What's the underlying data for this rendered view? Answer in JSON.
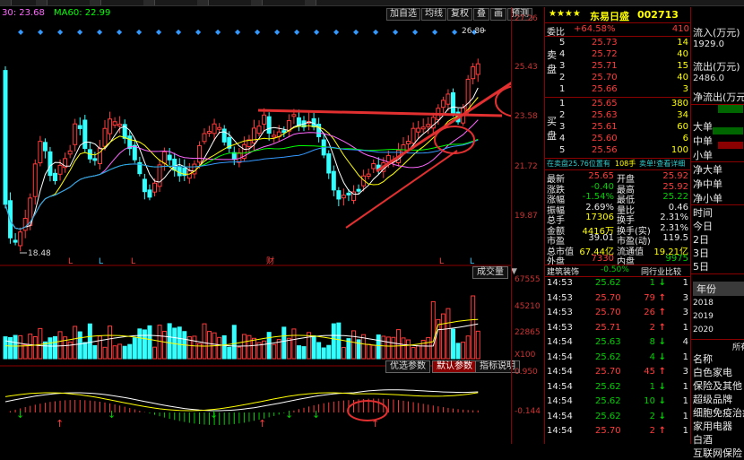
{
  "ma_labels": {
    "ma30": "30: 23.68",
    "ma60": "MA60: 22.99"
  },
  "toolbar": [
    "加自选",
    "均线",
    "复权",
    "叠",
    "画",
    "预测"
  ],
  "price_axis": [
    "27.26",
    "25.43",
    "23.58",
    "21.72",
    "19.87"
  ],
  "volume_axis": [
    "67555",
    "45210",
    "22865",
    "X100"
  ],
  "macd_axis": [
    "0.950",
    "-0.144"
  ],
  "price_annotations": {
    "high": "26.80",
    "low": "18.48"
  },
  "volume_button": "成交量",
  "bottom_buttons": [
    "优选参数",
    "默认参数",
    "指标说明"
  ],
  "marker_labels": [
    "L",
    "L",
    "L",
    "财",
    "L",
    "L"
  ],
  "stock": {
    "stars": "★★★★",
    "name": "东易日盛",
    "code": "002713"
  },
  "weibi": {
    "label": "委比",
    "value": "+64.58%",
    "count": "410"
  },
  "sell_label": "卖盘",
  "buy_label": "买盘",
  "sell": [
    {
      "lvl": "5",
      "price": "25.73",
      "vol": "14"
    },
    {
      "lvl": "4",
      "price": "25.72",
      "vol": "40"
    },
    {
      "lvl": "3",
      "price": "25.71",
      "vol": "15"
    },
    {
      "lvl": "2",
      "price": "25.70",
      "vol": "40"
    },
    {
      "lvl": "1",
      "price": "25.66",
      "vol": "3"
    }
  ],
  "buy": [
    {
      "lvl": "1",
      "price": "25.65",
      "vol": "380"
    },
    {
      "lvl": "2",
      "price": "25.63",
      "vol": "34"
    },
    {
      "lvl": "3",
      "price": "25.61",
      "vol": "60"
    },
    {
      "lvl": "4",
      "price": "25.60",
      "vol": "6"
    },
    {
      "lvl": "5",
      "price": "25.56",
      "vol": "100"
    }
  ],
  "buy_sell_info": {
    "left": "在卖盘25.76位置有",
    "mid": "108手",
    "right": "卖单!查看详细"
  },
  "stats": [
    {
      "k1": "最新",
      "v1": "25.65",
      "k2": "开盘",
      "v2": "25.92",
      "c1": "red",
      "c2": "red"
    },
    {
      "k1": "涨跌",
      "v1": "-0.40",
      "k2": "最高",
      "v2": "25.92",
      "c1": "green",
      "c2": "red"
    },
    {
      "k1": "涨幅",
      "v1": "-1.54%",
      "k2": "最低",
      "v2": "25.22",
      "c1": "green",
      "c2": "green"
    },
    {
      "k1": "振幅",
      "v1": "2.69%",
      "k2": "量比",
      "v2": "0.46",
      "c1": "white",
      "c2": "white"
    },
    {
      "k1": "总手",
      "v1": "17306",
      "k2": "换手",
      "v2": "2.31%",
      "c1": "yellow",
      "c2": "white"
    },
    {
      "k1": "金额",
      "v1": "4416万",
      "k2": "换手(实)",
      "v2": "2.31%",
      "c1": "yellow",
      "c2": "white"
    },
    {
      "k1": "市盈",
      "v1": "39.01",
      "k2": "市盈(动)",
      "v2": "119.5",
      "c1": "white",
      "c2": "white"
    },
    {
      "k1": "总市值",
      "v1": "67.44亿",
      "k2": "流通值",
      "v2": "19.21亿",
      "c1": "yellow",
      "c2": "yellow"
    },
    {
      "k1": "外盘",
      "v1": "7330",
      "k2": "内盘",
      "v2": "9975",
      "c1": "red",
      "c2": "green"
    }
  ],
  "sector": {
    "name": "建筑装饰",
    "change": "-0.50%",
    "link": "同行业比较"
  },
  "ticks": [
    {
      "time": "14:53",
      "price": "25.62",
      "vol": "1",
      "dir": "down",
      "n": "1"
    },
    {
      "time": "14:53",
      "price": "25.70",
      "vol": "79",
      "dir": "up",
      "n": "3"
    },
    {
      "time": "14:53",
      "price": "25.70",
      "vol": "26",
      "dir": "up",
      "n": "3"
    },
    {
      "time": "14:53",
      "price": "25.71",
      "vol": "2",
      "dir": "up",
      "n": "1"
    },
    {
      "time": "14:54",
      "price": "25.63",
      "vol": "8",
      "dir": "down",
      "n": "4"
    },
    {
      "time": "14:54",
      "price": "25.62",
      "vol": "4",
      "dir": "down",
      "n": "1"
    },
    {
      "time": "14:54",
      "price": "25.70",
      "vol": "45",
      "dir": "up",
      "n": "3"
    },
    {
      "time": "14:54",
      "price": "25.62",
      "vol": "1",
      "dir": "down",
      "n": "1"
    },
    {
      "time": "14:54",
      "price": "25.62",
      "vol": "10",
      "dir": "down",
      "n": "1"
    },
    {
      "time": "14:54",
      "price": "25.62",
      "vol": "2",
      "dir": "down",
      "n": "1"
    },
    {
      "time": "14:54",
      "price": "25.70",
      "vol": "2",
      "dir": "up",
      "n": "1"
    }
  ],
  "right_flow": [
    "流入(万元)",
    "1929.0",
    "流出(万元)",
    "2486.0",
    "净流出(万元)"
  ],
  "right_orders": [
    "大单",
    "中单",
    "小单"
  ],
  "right_net": [
    "净大单",
    "净中单",
    "净小单"
  ],
  "right_days": [
    "时间",
    "今日",
    "2日",
    "3日",
    "5日"
  ],
  "right_years": {
    "label": "年份",
    "items": [
      "2018",
      "2019",
      "2020"
    ]
  },
  "right_concepts": {
    "header": "所有",
    "label": "名称",
    "items": [
      "白色家电",
      "保险及其他",
      "超级品牌",
      "细胞免疫治疗",
      "家用电器",
      "白酒",
      "互联网保险"
    ]
  },
  "colors": {
    "up": "#ff3b3b",
    "down": "#00d000",
    "accent_bar": "#8b0000",
    "arrow": "#e23030"
  }
}
